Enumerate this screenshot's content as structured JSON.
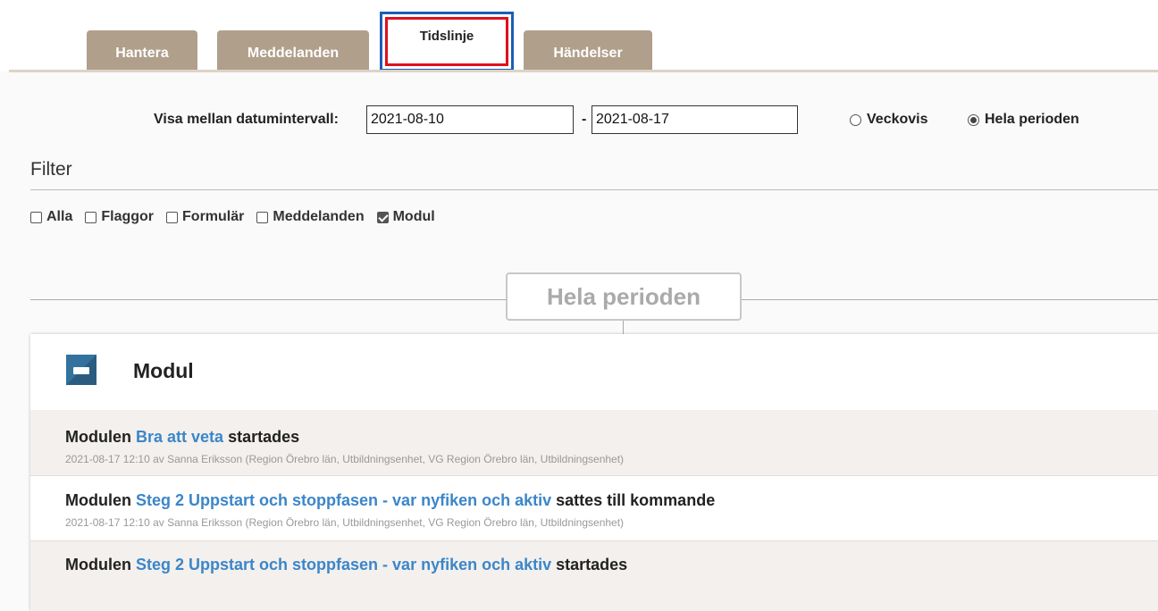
{
  "tabs": [
    {
      "label": "Hantera"
    },
    {
      "label": "Meddelanden"
    },
    {
      "label": "Tidslinje",
      "active": true
    },
    {
      "label": "Händelser"
    }
  ],
  "date_range": {
    "label": "Visa mellan datumintervall:",
    "from": "2021-08-10",
    "separator": "-",
    "to": "2021-08-17"
  },
  "view_mode": {
    "options": [
      {
        "label": "Veckovis",
        "selected": false
      },
      {
        "label": "Hela perioden",
        "selected": true
      }
    ]
  },
  "filter": {
    "title": "Filter",
    "options": [
      {
        "label": "Alla",
        "checked": false
      },
      {
        "label": "Flaggor",
        "checked": false
      },
      {
        "label": "Formulär",
        "checked": false
      },
      {
        "label": "Meddelanden",
        "checked": false
      },
      {
        "label": "Modul",
        "checked": true
      }
    ]
  },
  "period_label": "Hela perioden",
  "module_card": {
    "title": "Modul",
    "icon": "module-icon",
    "entries": [
      {
        "prefix": "Modulen",
        "link": "Bra att veta",
        "suffix": "startades",
        "meta": "2021-08-17 12:10 av Sanna Eriksson (Region Örebro län, Utbildningsenhet, VG Region Örebro län, Utbildningsenhet)"
      },
      {
        "prefix": "Modulen",
        "link": "Steg 2 Uppstart och stoppfasen - var nyfiken och aktiv",
        "suffix": "sattes till kommande",
        "meta": "2021-08-17 12:10 av Sanna Eriksson (Region Örebro län, Utbildningsenhet, VG Region Örebro län, Utbildningsenhet)"
      },
      {
        "prefix": "Modulen",
        "link": "Steg 2 Uppstart och stoppfasen - var nyfiken och aktiv",
        "suffix": "startades"
      }
    ]
  },
  "colors": {
    "tab": "#b09f8b",
    "active_tab_border": "#e0101d",
    "link": "#3b86c9",
    "module_icon": "#2b5c80"
  }
}
